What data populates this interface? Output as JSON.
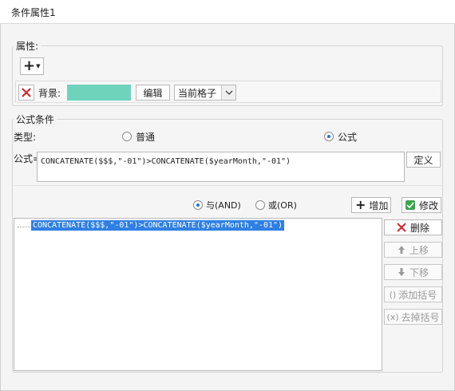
{
  "window": {
    "title": "条件属性1"
  },
  "properties": {
    "group_label": "属性:",
    "add_button": "+",
    "background_label": "背景:",
    "background_color": "#6fd3bb",
    "edit_button": "编辑",
    "scope_select": "当前格子"
  },
  "formula": {
    "group_label": "公式条件",
    "type_label": "类型:",
    "type_normal": "普通",
    "type_formula": "公式",
    "formula_label": "公式=",
    "formula_value": "CONCATENATE($$$,\"-01\")>CONCATENATE($yearMonth,\"-01\")",
    "define_button": "定义",
    "and_label": "与(AND)",
    "or_label": "或(OR)",
    "add_button": "增加",
    "modify_button": "修改",
    "conditions": [
      "CONCATENATE($$$,\"-01\")>CONCATENATE($yearMonth,\"-01\")"
    ],
    "delete_button": "删除",
    "up_button": "上移",
    "down_button": "下移",
    "add_bracket_button": "添加括号",
    "remove_bracket_button": "去掉括号"
  }
}
